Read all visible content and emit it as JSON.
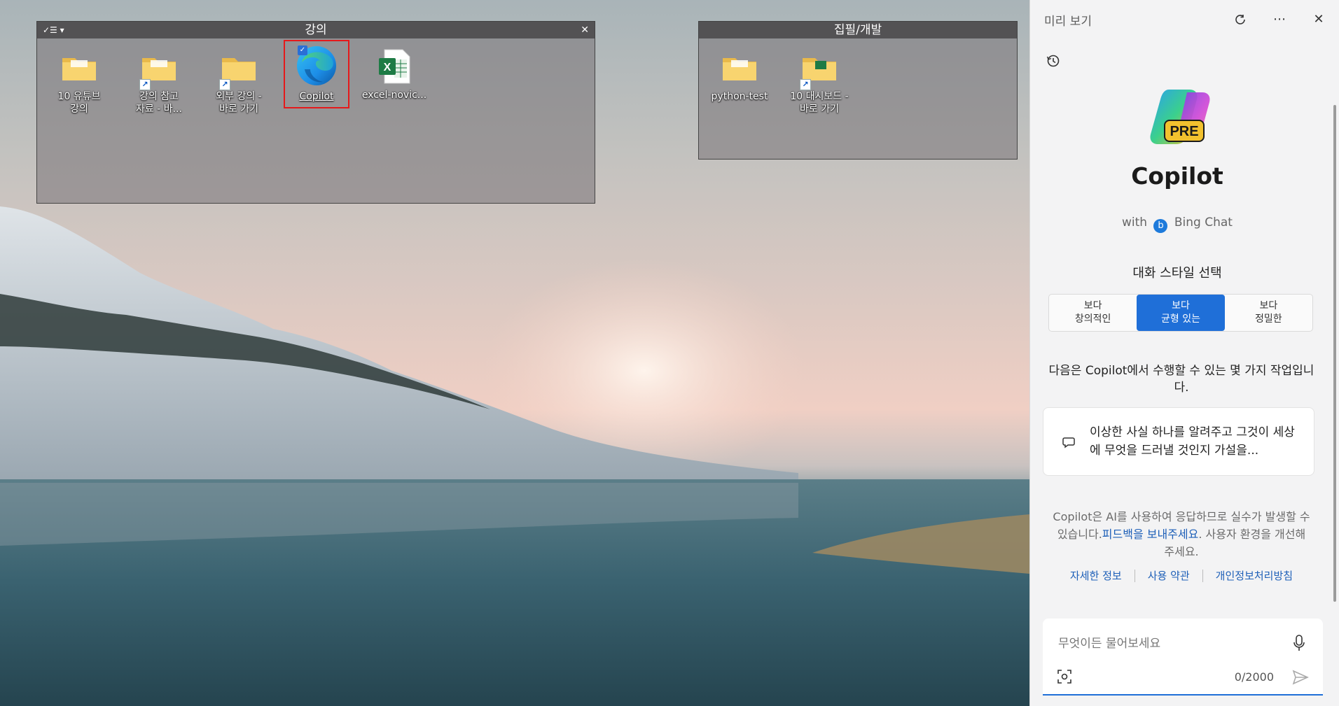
{
  "desktop": {
    "fences": [
      {
        "title": "강의",
        "menu_label": "✓☰ ▾",
        "close_label": "✕",
        "items": [
          {
            "label": "10 유튜브\n강의",
            "type": "folder",
            "shortcut": false
          },
          {
            "label": "강의 참고\n자료 - 바...",
            "type": "folder",
            "shortcut": true
          },
          {
            "label": "외부 강의 -\n바로 가기",
            "type": "folder",
            "shortcut": true
          },
          {
            "label": "Copilot",
            "type": "edge-app",
            "shortcut": false,
            "selected": true
          },
          {
            "label": "excel-novic...",
            "type": "excel-file",
            "shortcut": false
          }
        ]
      },
      {
        "title": "집필/개발",
        "items": [
          {
            "label": "python-test",
            "type": "folder",
            "shortcut": false
          },
          {
            "label": "10 대시보드 -\n바로 가기",
            "type": "folder",
            "shortcut": true
          }
        ]
      }
    ]
  },
  "panel": {
    "title": "미리 보기",
    "header_icons": [
      "refresh-icon",
      "more-icon",
      "close-icon"
    ],
    "logo_badge": "PRE",
    "app_name": "Copilot",
    "with_text": "with",
    "bing_text": "Bing Chat",
    "style_label": "대화 스타일 선택",
    "styles": [
      {
        "label": "보다\n창의적인",
        "active": false
      },
      {
        "label": "보다\n균형 있는",
        "active": true
      },
      {
        "label": "보다\n정밀한",
        "active": false
      }
    ],
    "intro": "다음은 Copilot에서 수행할 수 있는 몇 가지 작업입니다.",
    "suggestion": "이상한 사실 하나를 알려주고 그것이 세상에 무엇을 드러낼 것인지 가설을...",
    "disclaimer_before": "Copilot은 AI를 사용하여 응답하므로 실수가 발생할 수 있습니다.",
    "disclaimer_link": "피드백을 보내주세요",
    "disclaimer_after": ". 사용자 환경을 개선해 주세요.",
    "footer_links": [
      "자세한 정보",
      "사용 약관",
      "개인정보처리방침"
    ],
    "composer": {
      "placeholder": "무엇이든 물어보세요",
      "char_count": "0/2000"
    },
    "colors": {
      "accent": "#1f6fd8",
      "link": "#1d5fb8",
      "selection_border": "#e5191b"
    }
  }
}
